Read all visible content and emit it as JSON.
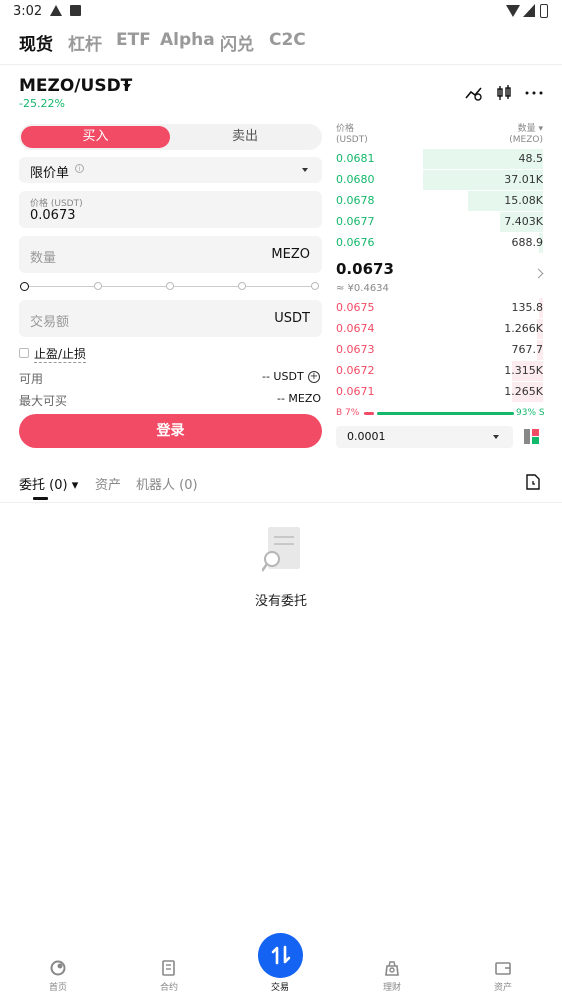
{
  "status_bar": {
    "time": "3:02"
  },
  "top_tabs": [
    "现货",
    "杠杆",
    "ETF",
    "Alpha",
    "闪兑",
    "C2C"
  ],
  "pair": {
    "name": "MEZO/USDT",
    "change": "-25.22%"
  },
  "trade": {
    "buy_label": "买入",
    "sell_label": "卖出",
    "order_type": "限价单",
    "price_label": "价格 (USDT)",
    "price_value": "0.0673",
    "amount_placeholder": "数量",
    "amount_unit": "MEZO",
    "total_placeholder": "交易额",
    "total_unit": "USDT",
    "tp_sl_label": "止盈/止损",
    "available_label": "可用",
    "available_value": "-- USDT",
    "max_buy_label": "最大可买",
    "max_buy_value": "-- MEZO",
    "login_label": "登录"
  },
  "order_book": {
    "price_header": "价格",
    "price_unit": "(USDT)",
    "qty_header": "数量",
    "qty_unit": "(MEZO)",
    "top_rows": [
      {
        "price": "0.0681",
        "qty": "48.5",
        "depth": 0.58
      },
      {
        "price": "0.0680",
        "qty": "37.01K",
        "depth": 0.58
      },
      {
        "price": "0.0678",
        "qty": "15.08K",
        "depth": 0.36
      },
      {
        "price": "0.0677",
        "qty": "7.403K",
        "depth": 0.21
      },
      {
        "price": "0.0676",
        "qty": "688.9",
        "depth": 0.02
      }
    ],
    "mid_price": "0.0673",
    "mid_fiat": "≈ ¥0.4634",
    "bottom_rows": [
      {
        "price": "0.0675",
        "qty": "135.8",
        "depth": 0.02
      },
      {
        "price": "0.0674",
        "qty": "1.266K",
        "depth": 0.03
      },
      {
        "price": "0.0673",
        "qty": "767.7",
        "depth": 0.03
      },
      {
        "price": "0.0672",
        "qty": "1.315K",
        "depth": 0.15
      },
      {
        "price": "0.0671",
        "qty": "1.265K",
        "depth": 0.15
      }
    ],
    "buy_ratio": "B 7%",
    "sell_ratio": "93% S",
    "precision": "0.0001"
  },
  "orders_tabs": {
    "orders": "委托 (0)",
    "assets": "资产",
    "robots": "机器人 (0)"
  },
  "empty_text": "没有委托",
  "bottom_nav": [
    "首页",
    "合约",
    "交易",
    "理财",
    "资产"
  ],
  "colors": {
    "buy": "#f24b65",
    "green": "#14b86b",
    "nav_active": "#1463f3"
  }
}
